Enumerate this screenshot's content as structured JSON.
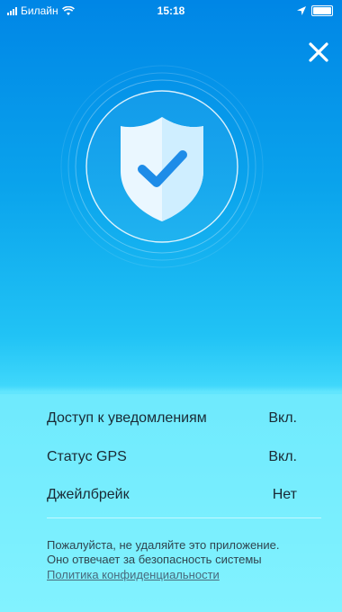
{
  "status_bar": {
    "carrier": "Билайн",
    "time": "15:18",
    "icons": [
      "signal-bars-icon",
      "wifi-icon",
      "location-arrow-icon",
      "battery-icon"
    ]
  },
  "header": {
    "close_icon": "close-icon"
  },
  "hero": {
    "icon": "shield-check-icon",
    "colors": {
      "shield": "#e6f6ff",
      "check": "#1e8ce8"
    }
  },
  "status_rows": [
    {
      "label": "Доступ к уведомлениям",
      "value": "Вкл."
    },
    {
      "label": "Статус GPS",
      "value": "Вкл."
    },
    {
      "label": "Джейлбрейк",
      "value": "Нет"
    }
  ],
  "footer": {
    "note_line1": "Пожалуйста, не удаляйте это приложение.",
    "note_line2": "Оно отвечает за безопасность системы",
    "privacy_link": "Политика конфиденциальности"
  }
}
